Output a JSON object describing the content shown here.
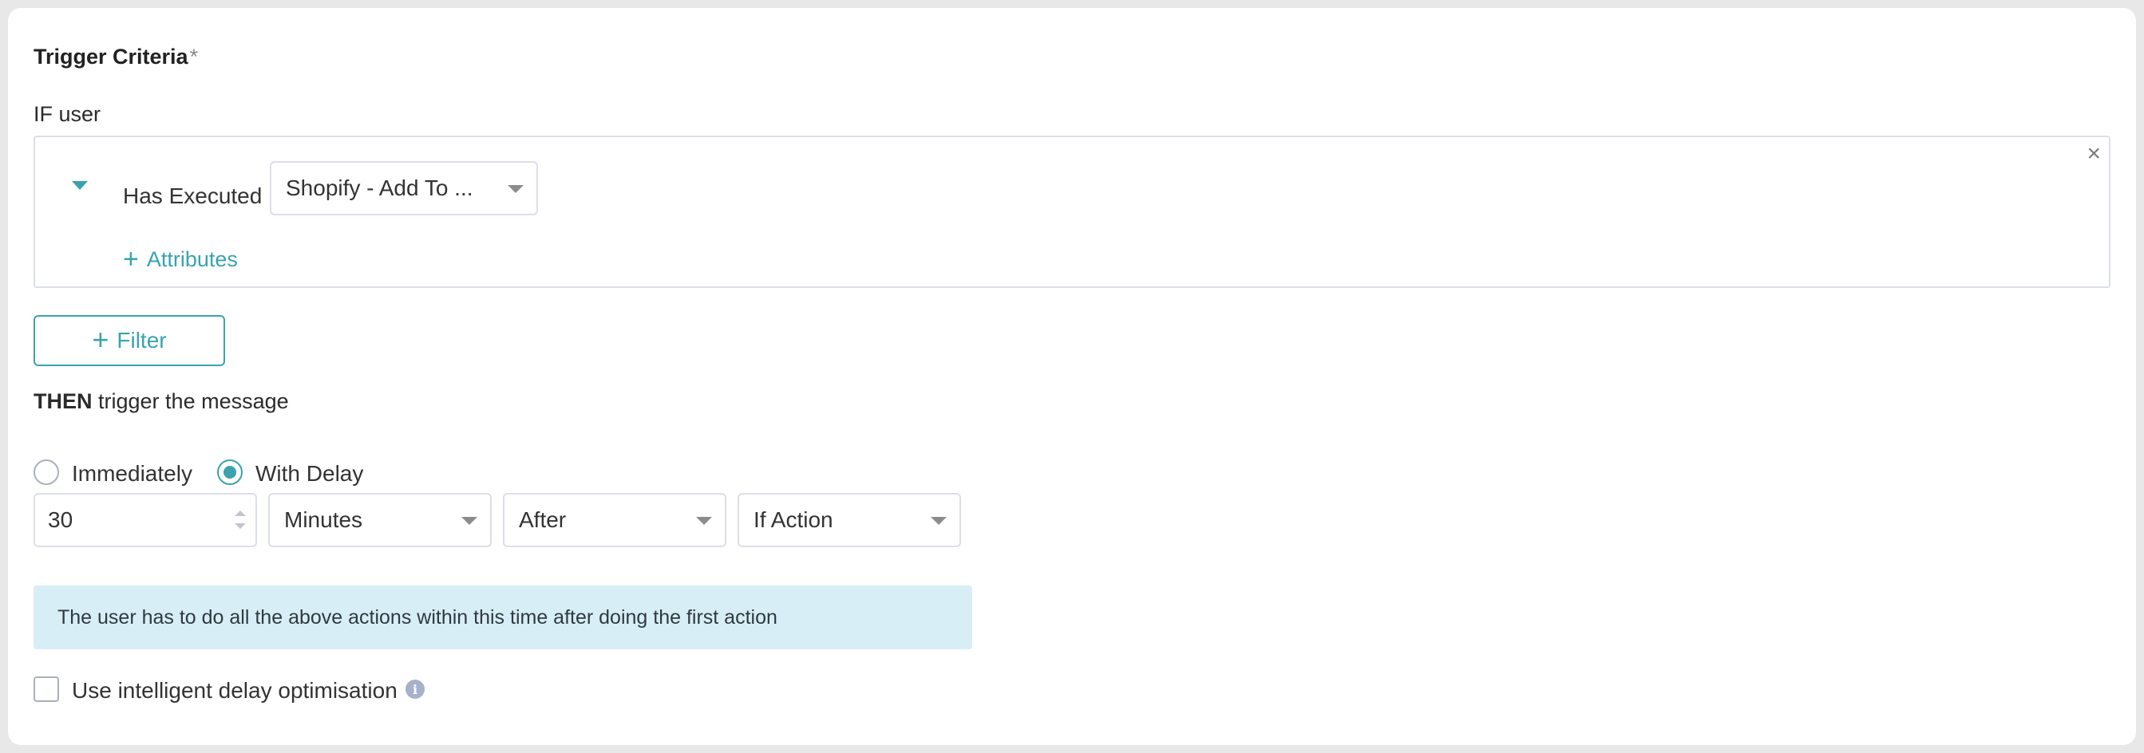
{
  "section": {
    "title": "Trigger Criteria",
    "required_mark": "*"
  },
  "condition": {
    "if_label": "IF user",
    "action_label": "Has Executed",
    "event_selected": "Shopify - Add To ...",
    "attributes_label": "Attributes"
  },
  "filter_button": "Filter",
  "then": {
    "prefix": "THEN",
    "rest": "trigger the message"
  },
  "timing": {
    "options": [
      "Immediately",
      "With Delay"
    ],
    "selected": "With Delay",
    "delay_value": "30",
    "unit_selected": "Minutes",
    "relation_selected": "After",
    "reference_selected": "If Action"
  },
  "info_banner": "The user has to do all the above actions within this time after doing the first action",
  "intelligent_delay": {
    "label": "Use intelligent delay optimisation",
    "checked": false
  },
  "colors": {
    "accent": "#3aa3ad",
    "banner_bg": "#d8eef6",
    "border": "#dcdfe6"
  }
}
